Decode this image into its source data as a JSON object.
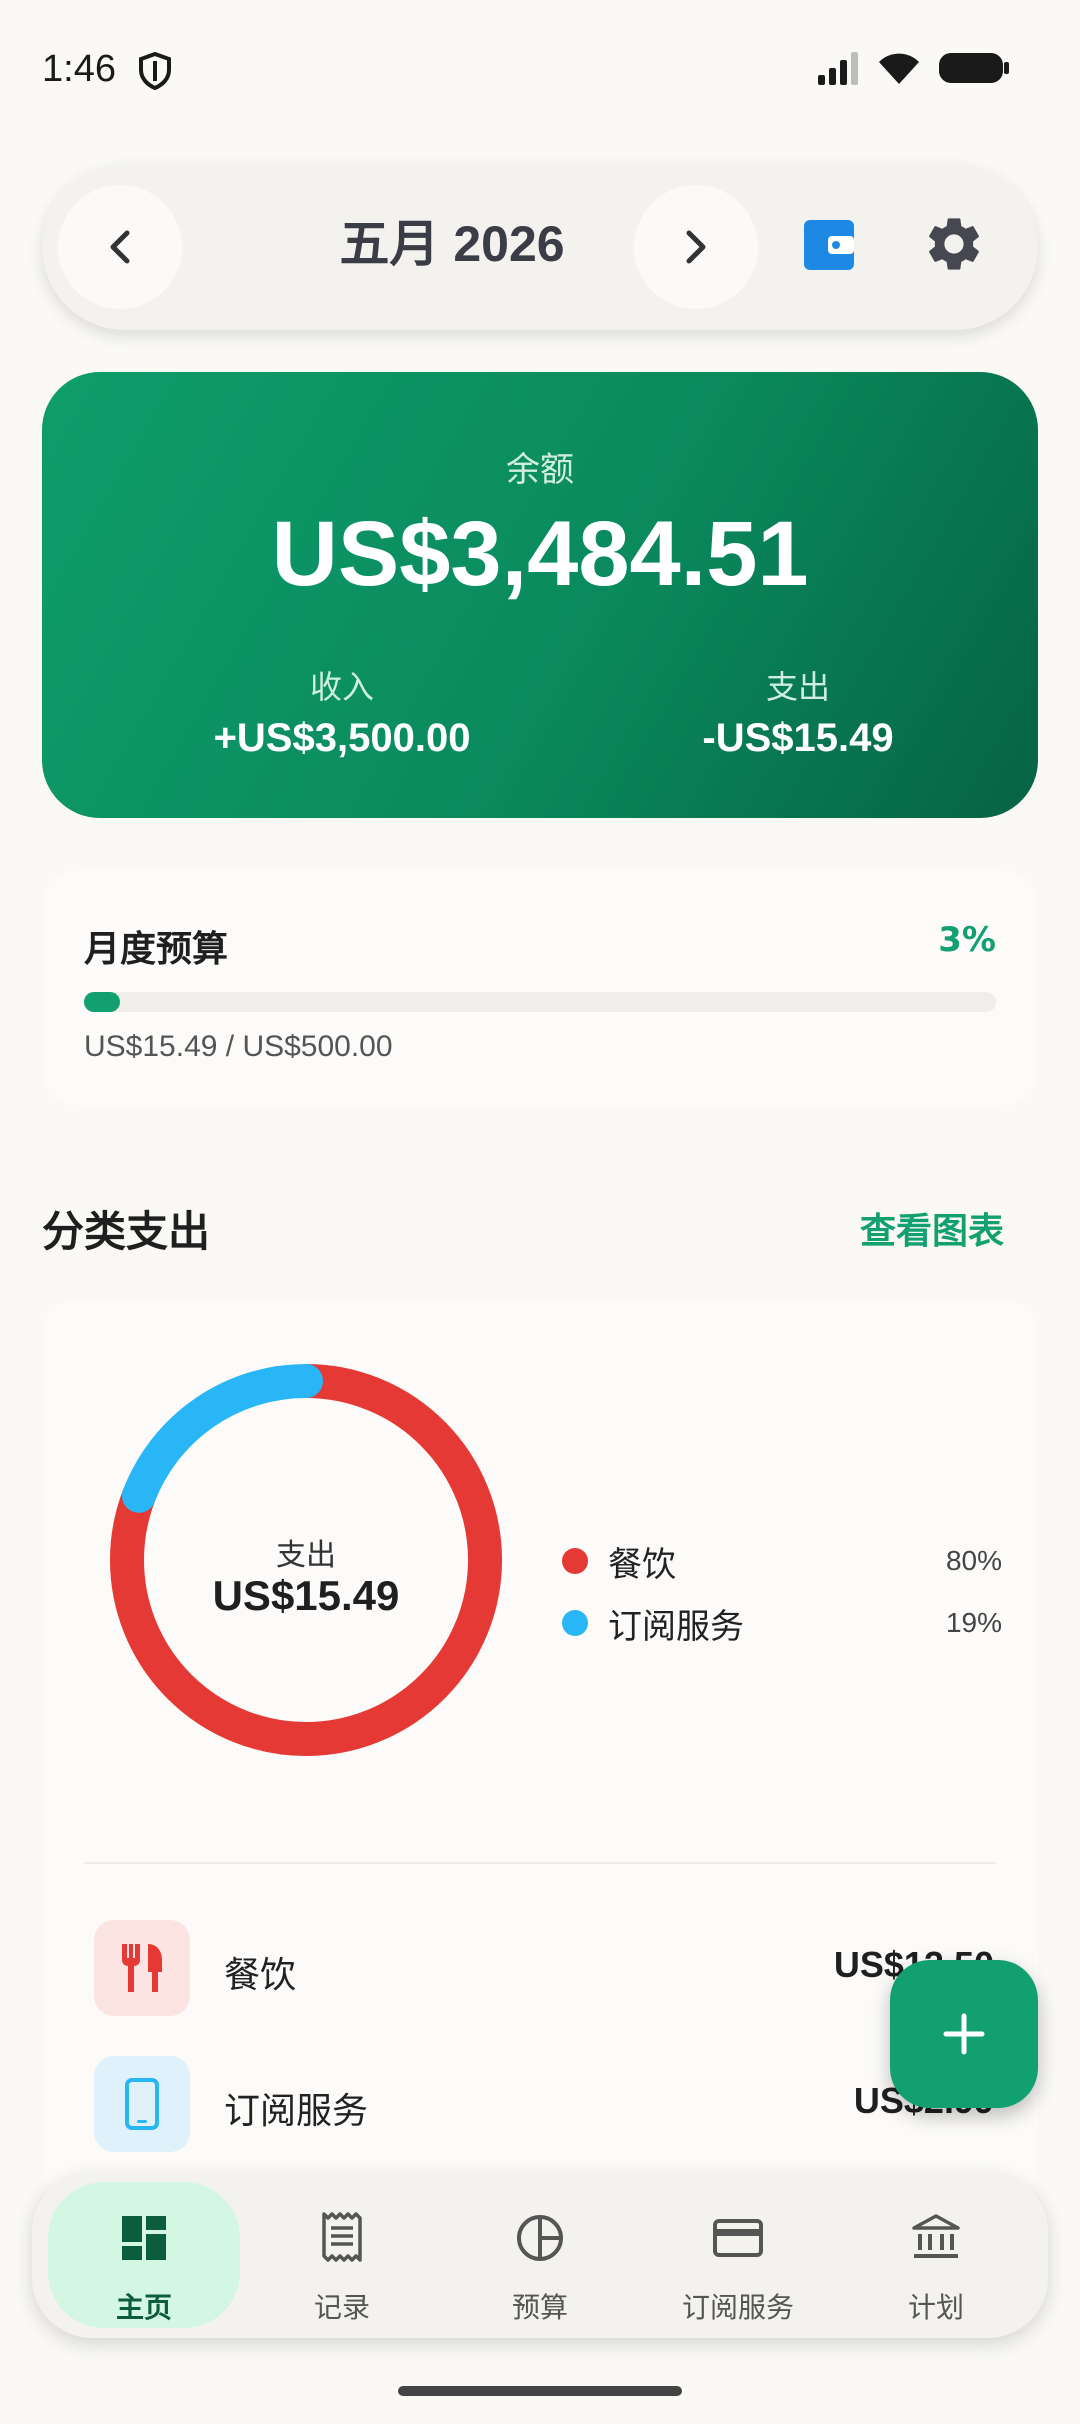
{
  "status_bar": {
    "time": "1:46"
  },
  "header": {
    "month_title": "五月 2026"
  },
  "balance": {
    "label": "余额",
    "value": "US$3,484.51",
    "income_label": "收入",
    "income_value": "+US$3,500.00",
    "expense_label": "支出",
    "expense_value": "-US$15.49"
  },
  "budget": {
    "title": "月度预算",
    "percent_label": "3%",
    "progress_fraction": 0.031,
    "summary": "US$15.49 / US$500.00"
  },
  "category_section": {
    "title": "分类支出",
    "link": "查看图表",
    "donut_label": "支出",
    "donut_value": "US$15.49",
    "legend": [
      {
        "name": "餐饮",
        "percent": "80%",
        "color": "#E53935",
        "share": 0.8
      },
      {
        "name": "订阅服务",
        "percent": "19%",
        "color": "#29B6F6",
        "share": 0.19
      }
    ],
    "rows": [
      {
        "name": "餐饮",
        "amount": "US$12.50",
        "icon": "utensils-icon",
        "icon_bg": "#FBE4E1",
        "icon_color": "#E53935"
      },
      {
        "name": "订阅服务",
        "amount": "US$2.99",
        "icon": "phone-icon",
        "icon_bg": "#DFF1FA",
        "icon_color": "#29B6F6"
      }
    ]
  },
  "nav": {
    "items": [
      {
        "label": "主页",
        "icon": "dashboard-icon",
        "active": true
      },
      {
        "label": "记录",
        "icon": "receipt-icon",
        "active": false
      },
      {
        "label": "预算",
        "icon": "pie-icon",
        "active": false
      },
      {
        "label": "订阅服务",
        "icon": "card-icon",
        "active": false
      },
      {
        "label": "计划",
        "icon": "bank-icon",
        "active": false
      }
    ]
  },
  "colors": {
    "accent": "#13A070",
    "card_gradient_start": "#0F9D6C",
    "card_gradient_end": "#066344"
  }
}
